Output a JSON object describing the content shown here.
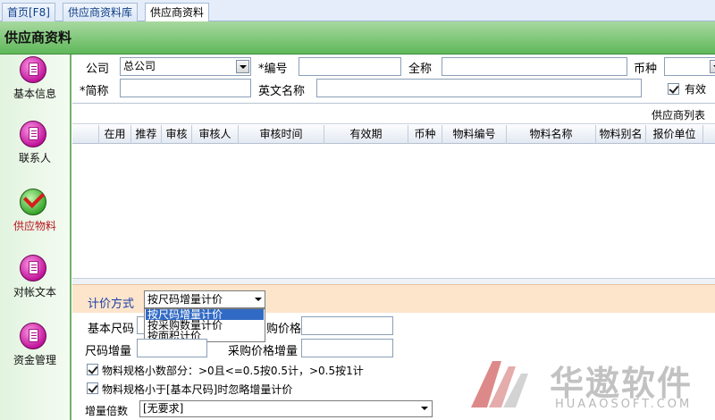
{
  "tabs": [
    {
      "label": "首页[F8]",
      "active": false
    },
    {
      "label": "供应商资料库",
      "active": false
    },
    {
      "label": "供应商资料",
      "active": true
    }
  ],
  "header": {
    "title": "供应商资料"
  },
  "sidebar": {
    "items": [
      {
        "label": "基本信息",
        "icon": "document-icon",
        "active": false
      },
      {
        "label": "联系人",
        "icon": "document-icon",
        "active": false
      },
      {
        "label": "供应物料",
        "icon": "checkmark-icon",
        "active": true
      },
      {
        "label": "对帐文本",
        "icon": "document-icon",
        "active": false
      },
      {
        "label": "资金管理",
        "icon": "document-icon",
        "active": false
      }
    ]
  },
  "form": {
    "company_label": "公司",
    "company_value": "总公司",
    "code_label": "*编号",
    "code_value": "",
    "fullname_label": "全称",
    "fullname_value": "",
    "currency_label": "币种",
    "currency_value": "",
    "shortname_label": "*简称",
    "shortname_value": "",
    "english_label": "英文名称",
    "english_value": "",
    "valid_label": "有效",
    "valid_checked": true
  },
  "grid": {
    "caption": "供应商列表",
    "columns": [
      "在用",
      "推荐",
      "审核",
      "审核人",
      "审核时间",
      "有效期",
      "币种",
      "物料编号",
      "物料名称",
      "物料别名",
      "报价单位"
    ]
  },
  "pricing": {
    "method_label": "计价方式",
    "method_value": "按尺码增量计价",
    "method_options": [
      "按尺码增量计价",
      "按采购数量计价",
      "按面积计价"
    ],
    "base_size_label": "基本尺码",
    "base_size_value": "",
    "purchase_price_label": "购价格",
    "purchase_price_value": "",
    "size_inc_label": "尺码增量",
    "size_inc_value": "",
    "price_inc_label": "采购价格增量",
    "price_inc_value": "",
    "rule1_label": "物料规格小数部分：>0且<=0.5按0.5计，>0.5按1计",
    "rule1_checked": true,
    "rule2_label": "物料规格小于[基本尺码]时忽略增量计价",
    "rule2_checked": true,
    "multiplier_label": "增量倍数",
    "multiplier_value": "[无要求]"
  },
  "watermark": {
    "brand_cn": "华遨软件",
    "brand_en": "HUAAOSOFT.COM"
  },
  "colors": {
    "header_green": "#5fb85a",
    "price_bar": "#fde5cc",
    "selection": "#316ac5",
    "logo_red": "#c42a2a",
    "logo_gray": "#8a8a8a"
  }
}
